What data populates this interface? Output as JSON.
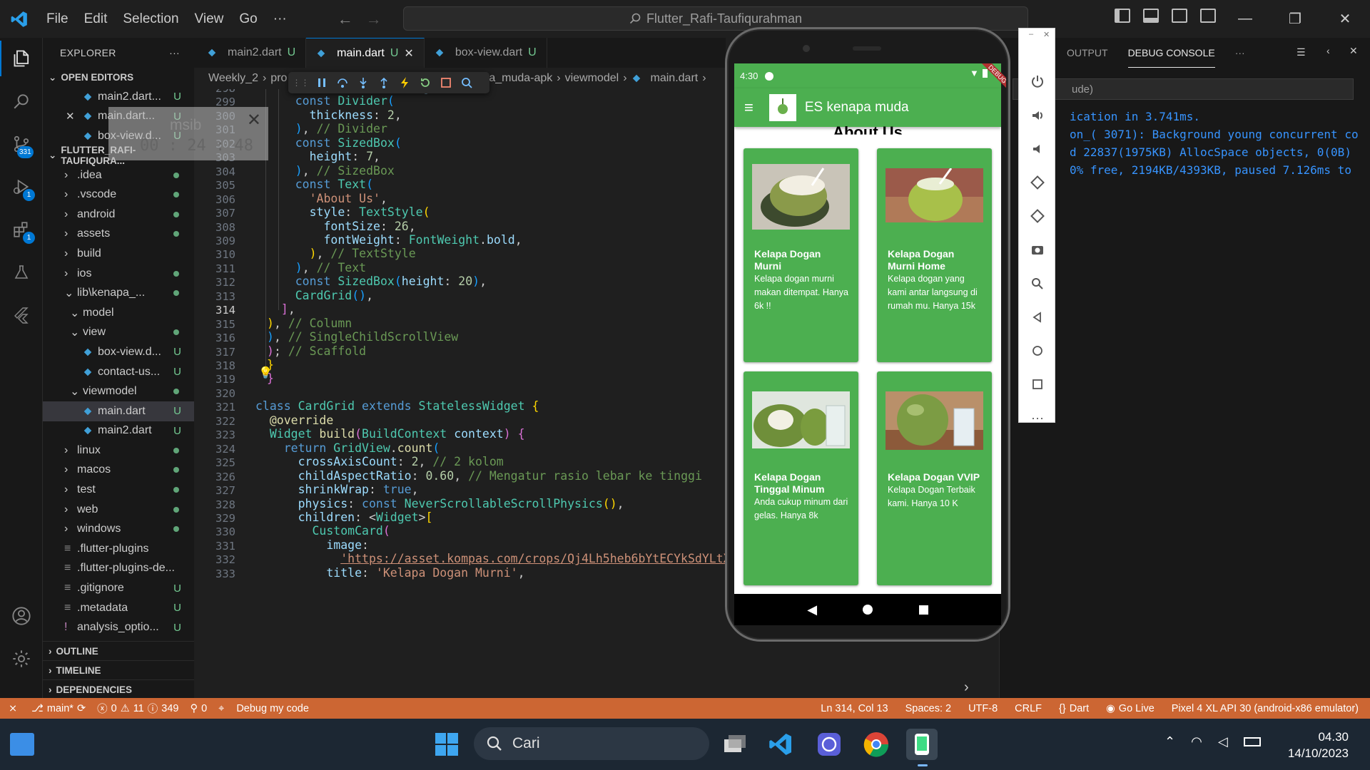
{
  "titlebar": {
    "menu": [
      "File",
      "Edit",
      "Selection",
      "View",
      "Go",
      "···"
    ],
    "search": "Flutter_Rafi-Taufiqurahman"
  },
  "sidebar": {
    "explorer_title": "EXPLORER",
    "more": "···",
    "open_editors_title": "OPEN EDITORS",
    "open_editors": [
      {
        "label": "main2.dart...",
        "status": "U"
      },
      {
        "label": "main.dart...",
        "status": "U"
      },
      {
        "label": "box-view.d...",
        "status": "U"
      }
    ],
    "project_title": "FLUTTER_RAFI-TAUFIQURA...",
    "tree": [
      {
        "label": ".idea",
        "status": "dot"
      },
      {
        "label": ".vscode",
        "status": "dot"
      },
      {
        "label": "android",
        "status": "dot"
      },
      {
        "label": "assets",
        "status": "dot"
      },
      {
        "label": "build",
        "status": ""
      },
      {
        "label": "ios",
        "status": "dot"
      },
      {
        "label": "lib\\kenapa_...",
        "status": "dot"
      },
      {
        "label": "model",
        "status": ""
      },
      {
        "label": "view",
        "status": "dot"
      },
      {
        "label": "box-view.d...",
        "status": "U"
      },
      {
        "label": "contact-us...",
        "status": "U"
      },
      {
        "label": "viewmodel",
        "status": "dot"
      },
      {
        "label": "main.dart",
        "status": "U"
      },
      {
        "label": "main2.dart",
        "status": "U"
      },
      {
        "label": "linux",
        "status": "dot"
      },
      {
        "label": "macos",
        "status": "dot"
      },
      {
        "label": "test",
        "status": "dot"
      },
      {
        "label": "web",
        "status": "dot"
      },
      {
        "label": "windows",
        "status": "dot"
      },
      {
        "label": ".flutter-plugins",
        "status": ""
      },
      {
        "label": ".flutter-plugins-de...",
        "status": ""
      },
      {
        "label": ".gitignore",
        "status": "U"
      },
      {
        "label": ".metadata",
        "status": "U"
      },
      {
        "label": "analysis_optio...",
        "status": "U"
      }
    ],
    "outline": "OUTLINE",
    "timeline": "TIMELINE",
    "dependencies": "DEPENDENCIES",
    "badges": {
      "scm": "331",
      "debug": "1",
      "extensions": "1"
    }
  },
  "timer": {
    "label": "msib",
    "time": "00 : 24 : 48"
  },
  "tabs": [
    {
      "label": "main2.dart",
      "status": "U"
    },
    {
      "label": "main.dart",
      "status": "U"
    },
    {
      "label": "box-view.dart",
      "status": "U"
    }
  ],
  "breadcrumb": [
    "Weekly_2",
    "pro",
    "pa_muda-apk",
    "viewmodel",
    "main.dart"
  ],
  "editor": {
    "line_numbers": [
      "298",
      "299",
      "300",
      "301",
      "302",
      "303",
      "304",
      "305",
      "306",
      "307",
      "308",
      "309",
      "310",
      "311",
      "312",
      "313",
      "314",
      "315",
      "316",
      "317",
      "318",
      "319",
      "320",
      "321",
      "322",
      "323",
      "324",
      "325",
      "326",
      "327",
      "328",
      "329",
      "330",
      "331",
      "332",
      "333"
    ],
    "current_line": "314"
  },
  "panel": {
    "tabs": [
      "OUTPUT",
      "DEBUG CONSOLE",
      "···"
    ],
    "filter": "ude)",
    "lines": [
      "ication in 3.741ms.",
      "on_( 3071): Background young concurrent co",
      "d 22837(1975KB) AllocSpace objects, 0(0B)",
      "0% free, 2194KB/4393KB, paused 7.126ms to"
    ]
  },
  "phone": {
    "time": "4:30",
    "app_title": "ES kenapa muda",
    "about": "About Us",
    "debug": "DEBUG",
    "cards": [
      {
        "title": "Kelapa Dogan Murni",
        "desc": "Kelapa dogan murni makan ditempat. Hanya 6k !!"
      },
      {
        "title": "Kelapa Dogan Murni Home",
        "desc": "Kelapa dogan yang kami antar langsung di rumah mu. Hanya 15k"
      },
      {
        "title": "Kelapa Dogan Tinggal Minum",
        "desc": "Anda cukup minum dari gelas. Hanya 8k"
      },
      {
        "title": "Kelapa Dogan VVIP",
        "desc": "Kelapa Dogan Terbaik kami. Hanya 10 K"
      }
    ]
  },
  "statusbar": {
    "branch": "main*",
    "errors": "0",
    "warnings": "11",
    "infos": "349",
    "ports": "0",
    "debug": "Debug my code",
    "position": "Ln 314, Col 13",
    "spaces": "Spaces: 2",
    "encoding": "UTF-8",
    "eol": "CRLF",
    "language": "Dart",
    "golive": "Go Live",
    "device": "Pixel 4 XL API 30 (android-x86 emulator)"
  },
  "taskbar": {
    "search": "Cari",
    "time": "04.30",
    "date": "14/10/2023"
  },
  "colors": {
    "accent": "#0078d4",
    "statusbar": "#cc6633",
    "app_green": "#4caf50"
  }
}
